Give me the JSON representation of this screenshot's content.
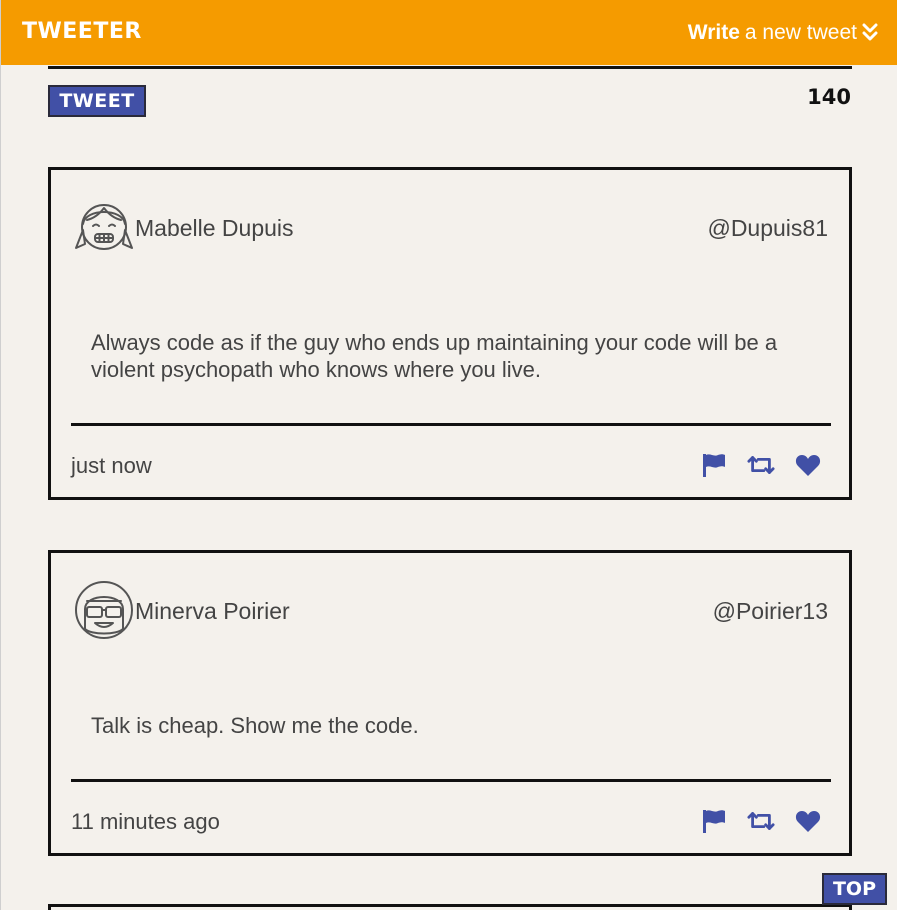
{
  "nav": {
    "brand": "TWEETER",
    "compose_bold": "Write",
    "compose_rest": "a new tweet",
    "compose_icon": "double-chevron-down-icon"
  },
  "composer": {
    "submit_label": "TWEET",
    "char_counter": "140"
  },
  "tweets": [
    {
      "author_name": "Mabelle Dupuis",
      "handle": "@Dupuis81",
      "avatar_icon": "girl-pigtails-avatar-icon",
      "content": "Always code as if the guy who ends up maintaining your code will be a violent psychopath who knows where you live.",
      "timestamp": "just now",
      "actions": [
        "flag-icon",
        "retweet-icon",
        "heart-icon"
      ]
    },
    {
      "author_name": "Minerva Poirier",
      "handle": "@Poirier13",
      "avatar_icon": "sunglasses-avatar-icon",
      "content": "Talk is cheap. Show me the code.",
      "timestamp": "11 minutes ago",
      "actions": [
        "flag-icon",
        "retweet-icon",
        "heart-icon"
      ]
    }
  ],
  "scroll_top_label": "TOP",
  "colors": {
    "nav_background": "#f59b00",
    "page_background": "#f4f1ec",
    "accent": "#4150a6",
    "text": "#444444",
    "border": "#111111"
  }
}
